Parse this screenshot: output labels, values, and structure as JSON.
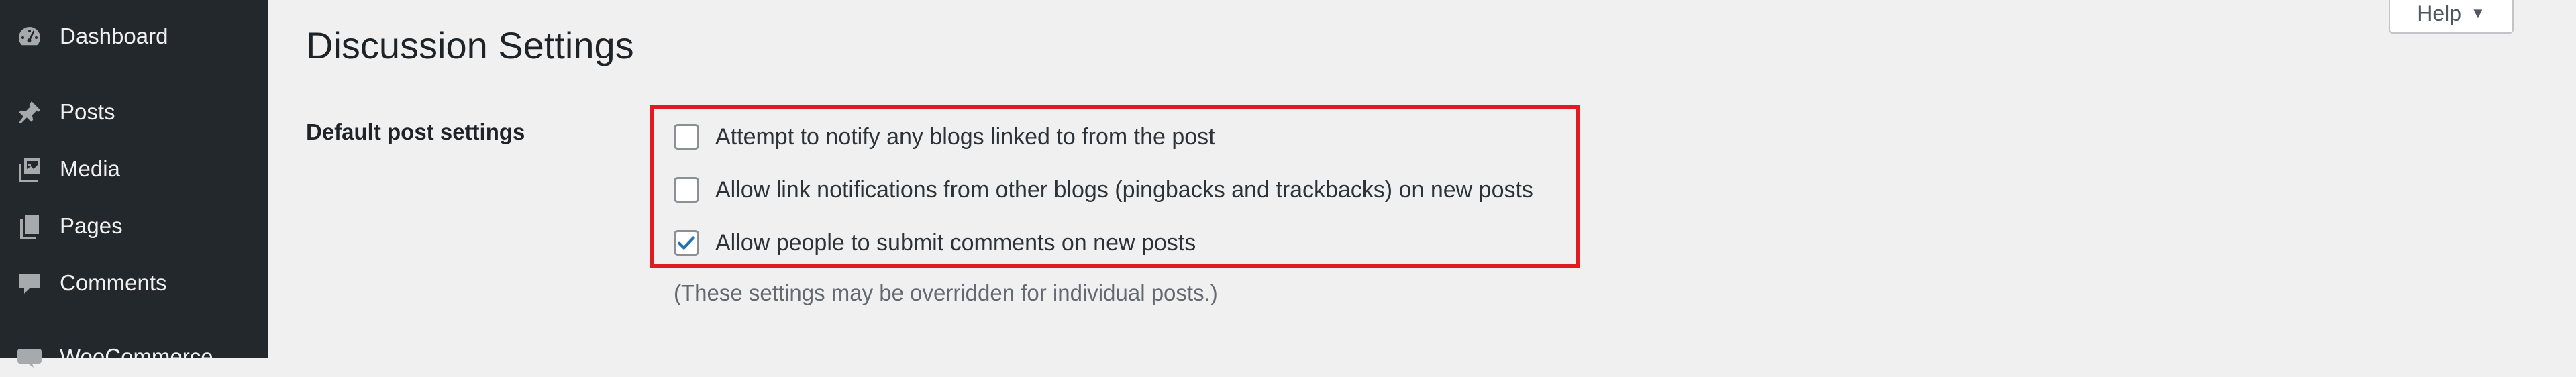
{
  "sidebar": {
    "items": [
      {
        "label": "Dashboard",
        "icon": "dashboard-icon"
      },
      {
        "label": "Posts",
        "icon": "pushpin-icon"
      },
      {
        "label": "Media",
        "icon": "media-icon"
      },
      {
        "label": "Pages",
        "icon": "pages-icon"
      },
      {
        "label": "Comments",
        "icon": "comments-icon"
      },
      {
        "label": "WooCommerce",
        "icon": "woocommerce-icon"
      }
    ]
  },
  "header": {
    "help_label": "Help",
    "help_arrow": "▼"
  },
  "main": {
    "title": "Discussion Settings",
    "section_label": "Default post settings",
    "options": [
      {
        "label": "Attempt to notify any blogs linked to from the post",
        "checked": false
      },
      {
        "label": "Allow link notifications from other blogs (pingbacks and trackbacks) on new posts",
        "checked": false
      },
      {
        "label": "Allow people to submit comments on new posts",
        "checked": true
      }
    ],
    "note": "(These settings may be overridden for individual posts.)"
  },
  "colors": {
    "sidebar_bg": "#23282d",
    "page_bg": "#f0f0f1",
    "highlight": "#e11b22",
    "check": "#2271b1"
  }
}
